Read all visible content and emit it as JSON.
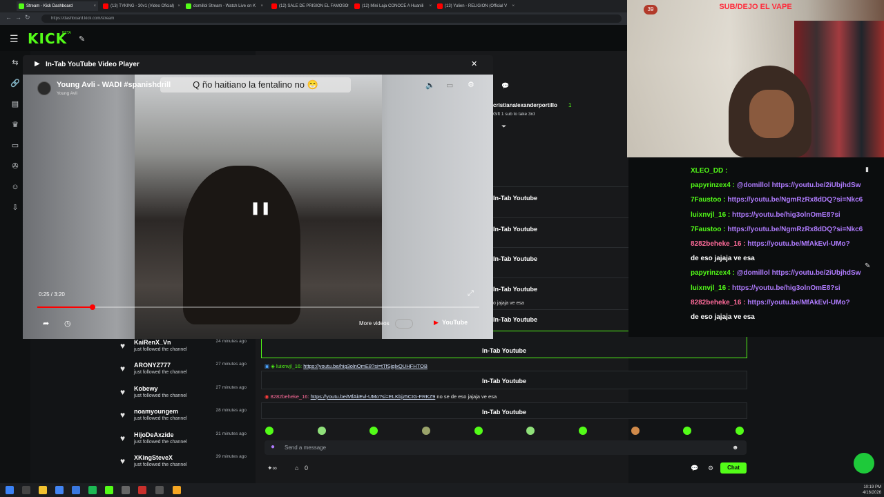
{
  "browser": {
    "tabs": [
      {
        "label": "Stream - Kick Dashboard",
        "color": "#53fc18"
      },
      {
        "label": "(13) TYKING - 30v1 (Video Oficial)",
        "color": "#ff0000"
      },
      {
        "label": "domillol Stream - Watch Live on K",
        "color": "#53fc18"
      },
      {
        "label": "(12) SALE DE PRISION EL FAMOSO",
        "color": "#ff0000"
      },
      {
        "label": "(12) Mini Laja CONOCE A Huanili",
        "color": "#ff0000"
      },
      {
        "label": "(13) Yulien - RELIGION (Official V",
        "color": "#ff0000"
      }
    ],
    "url": "https://dashboard.kick.com/stream"
  },
  "header": {
    "logo": "KICK",
    "badge": "BETA"
  },
  "player": {
    "modal_title": "In-Tab YouTube Video Player",
    "video_title": "Young Avli - WADI #spanishdrill",
    "channel": "Young Avli",
    "caption": "Q ño haitiano la fentalino no 😁",
    "time": "0:25 / 3:20",
    "progress": 0.125,
    "more_videos": "More videos",
    "brand": "YouTube"
  },
  "chat_header": {
    "user": "cristianalexanderportillo",
    "count": "1",
    "note": "Gift 1 sub to take 3rd"
  },
  "rewards_right": [
    "In-Tab Youtube",
    "In-Tab Youtube",
    "In-Tab Youtube",
    "In-Tab Youtube",
    "In-Tab Youtube"
  ],
  "reward_partial": "o jajaja ve esa",
  "rewards_box": [
    {
      "label": "In-Tab Youtube",
      "highlight": true
    },
    {
      "label": "In-Tab Youtube",
      "highlight": false
    },
    {
      "label": "In-Tab Youtube",
      "highlight": false
    }
  ],
  "chat_lines": [
    {
      "user": "luixnvjl_16:",
      "link": "https://youtu.be/hig3olnOmE8?si=tTfSjqlxQUHFHTOB",
      "rest": ""
    },
    {
      "user": "8282beheke_16:",
      "link": "https://youtu.be/MfAkEvl-UMo?si=ELKbjz5CIG-FRKZ9",
      "rest": " no se de eso jajaja ve esa"
    }
  ],
  "followers": [
    {
      "name": "KaiRenX_Vn",
      "action": "just followed the channel",
      "time": "24 minutes ago"
    },
    {
      "name": "ARONYZ777",
      "action": "just followed the channel",
      "time": "27 minutes ago"
    },
    {
      "name": "Kobewy",
      "action": "just followed the channel",
      "time": "27 minutes ago"
    },
    {
      "name": "noamyoungem",
      "action": "just followed the channel",
      "time": "28 minutes ago"
    },
    {
      "name": "HijoDeAxzide",
      "action": "just followed the channel",
      "time": "31 minutes ago"
    },
    {
      "name": "XKingSteveX",
      "action": "just followed the channel",
      "time": "39 minutes ago"
    }
  ],
  "message_input": {
    "placeholder": "Send a message"
  },
  "chat_footer": {
    "count": "0",
    "chat_button": "Chat"
  },
  "overlay": {
    "banner": "SUB/DEJO EL VAPE",
    "badge": "39",
    "lines": [
      {
        "user": "XLEO_DD :",
        "msg": "",
        "color": "#53fc18"
      },
      {
        "user": "papyrinzex4 :",
        "msg": "@domillol https://youtu.be/2iUbjhdSw",
        "color": "#53fc18"
      },
      {
        "user": "7Faustoo :",
        "msg": "https://youtu.be/NgmRzRx8dDQ?si=Nkc6",
        "color": "#53fc18"
      },
      {
        "user": "luixnvjl_16 :",
        "msg": "https://youtu.be/hig3olnOmE8?si",
        "color": "#53fc18"
      },
      {
        "user": "7Faustoo :",
        "msg": "https://youtu.be/NgmRzRx8dDQ?si=Nkc6",
        "color": "#53fc18"
      },
      {
        "user": "8282beheke_16 :",
        "msg": "https://youtu.be/MfAkEvl-UMo?",
        "color": "#ff6b9a"
      },
      {
        "user": "",
        "msg": "de eso jajaja ve esa",
        "color": "#ffffff"
      },
      {
        "user": "papyrinzex4 :",
        "msg": "@domillol https://youtu.be/2iUbjhdSw",
        "color": "#53fc18"
      },
      {
        "user": "luixnvjl_16 :",
        "msg": "https://youtu.be/hig3olnOmE8?si",
        "color": "#53fc18"
      },
      {
        "user": "8282beheke_16 :",
        "msg": "https://youtu.be/MfAkEvl-UMo?",
        "color": "#ff6b9a"
      },
      {
        "user": "",
        "msg": "de eso jajaja ve esa",
        "color": "#ffffff"
      }
    ]
  },
  "taskbar": {
    "time": "10:19 PM",
    "date": "4/16/2026"
  }
}
